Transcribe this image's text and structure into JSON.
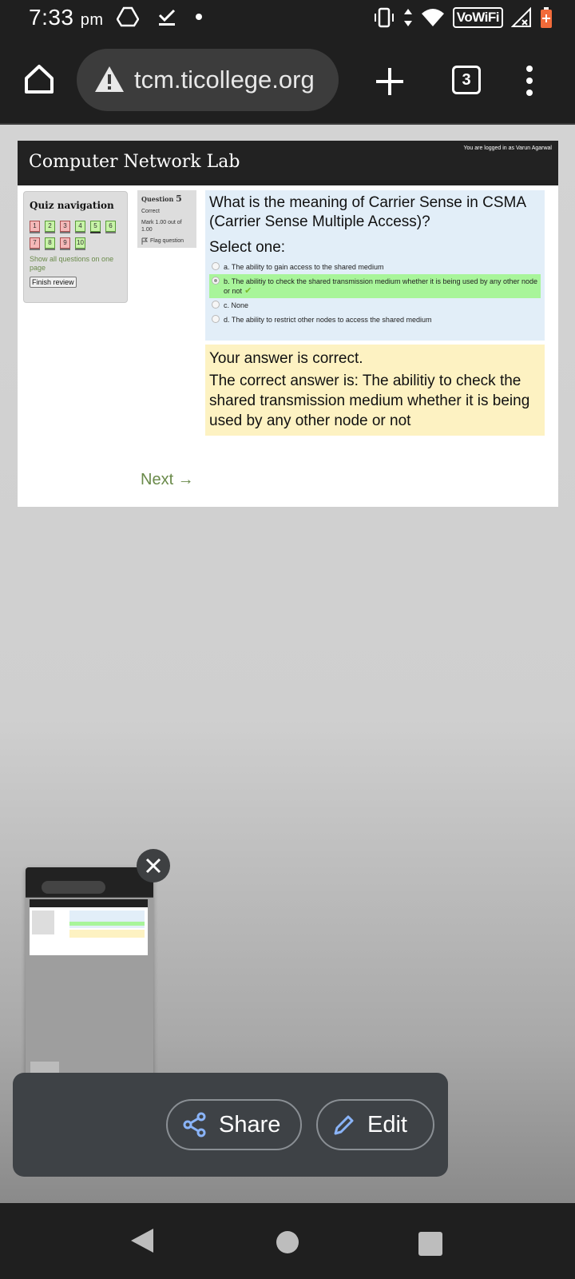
{
  "status_bar": {
    "time": "7:33",
    "ampm": "pm",
    "network_label": "VoWiFi",
    "icons": [
      "drive-icon",
      "download-done-icon",
      "dot-icon",
      "vibrate-icon",
      "data-arrows-icon",
      "wifi-icon",
      "signal-off-icon",
      "battery-low-icon"
    ]
  },
  "browser": {
    "url": "tcm.ticollege.org",
    "tab_count": "3"
  },
  "page": {
    "site_title": "Computer Network Lab",
    "login_info": "You are logged in as Varun Agarwal",
    "quiz_nav": {
      "title": "Quiz navigation",
      "questions": [
        {
          "num": "1",
          "state": "incorrect"
        },
        {
          "num": "2",
          "state": "correct"
        },
        {
          "num": "3",
          "state": "incorrect"
        },
        {
          "num": "4",
          "state": "correct"
        },
        {
          "num": "5",
          "state": "correct"
        },
        {
          "num": "6",
          "state": "correct"
        },
        {
          "num": "7",
          "state": "incorrect"
        },
        {
          "num": "8",
          "state": "correct"
        },
        {
          "num": "9",
          "state": "incorrect"
        },
        {
          "num": "10",
          "state": "correct"
        }
      ],
      "show_all": "Show all questions on one page",
      "finish_review": "Finish review"
    },
    "question_info": {
      "label": "Question",
      "number": "5",
      "state": "Correct",
      "mark": "Mark 1.00 out of 1.00",
      "flag": "Flag question"
    },
    "question": {
      "text": "What is the meaning of Carrier Sense in CSMA (Carrier Sense Multiple Access)?",
      "prompt": "Select one:",
      "options": [
        "a. The ability to gain access to the shared medium",
        "b. The abilitiy to check the shared transmission medium whether it is being used by any other node or not",
        "c. None",
        "d. The ability to restrict other nodes to access the shared medium"
      ],
      "selected_index": 1
    },
    "feedback": {
      "result": "Your answer is correct.",
      "correct_answer": "The correct answer is: The abilitiy to check the shared transmission medium whether it is being used by any other node or not"
    },
    "next_link": "Next →"
  },
  "screenshot_actions": {
    "share_label": "Share",
    "edit_label": "Edit"
  },
  "colors": {
    "correct_bg": "#a8f59a",
    "question_bg": "#e2eef8",
    "feedback_bg": "#fdf2c2",
    "header_bg": "#222222"
  }
}
